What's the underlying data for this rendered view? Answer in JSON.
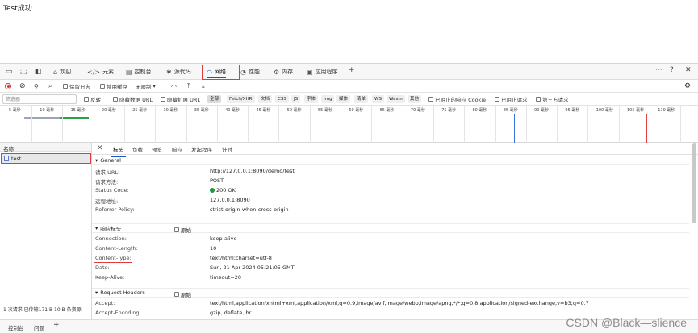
{
  "page": {
    "title": "Test成功"
  },
  "tabbar": {
    "tabs": [
      {
        "label": "欢迎",
        "icon": "home-icon"
      },
      {
        "label": "元素",
        "icon": "code-icon"
      },
      {
        "label": "控制台",
        "icon": "console-icon"
      },
      {
        "label": "源代码",
        "icon": "bug-icon"
      },
      {
        "label": "网络",
        "icon": "wifi-icon"
      },
      {
        "label": "性能",
        "icon": "performance-icon"
      },
      {
        "label": "内存",
        "icon": "memory-icon"
      },
      {
        "label": "应用程序",
        "icon": "app-icon"
      }
    ],
    "active": "网络",
    "add": "+",
    "more": "···",
    "help": "?",
    "close": "✕"
  },
  "toolbar1": {
    "preserve_log": "保留日志",
    "disable_cache": "禁用缓存",
    "throttle": "无限制"
  },
  "toolbar2": {
    "filter_placeholder": "筛选器",
    "invert": "反转",
    "hide_data_urls": "隐藏数据 URL",
    "hide_ext_urls": "隐藏扩展 URL",
    "chips": [
      "全部",
      "Fetch/XHR",
      "文档",
      "CSS",
      "JS",
      "字体",
      "Img",
      "媒体",
      "清单",
      "WS",
      "Wasm",
      "其他"
    ],
    "blocked_cookies": "已阻止的响应 Cookie",
    "blocked_requests": "已阻止请求",
    "third_party": "第三方请求"
  },
  "timeline": {
    "ticks": [
      "5 毫秒",
      "10 毫秒",
      "15 毫秒",
      "20 毫秒",
      "25 毫秒",
      "30 毫秒",
      "35 毫秒",
      "40 毫秒",
      "45 毫秒",
      "50 毫秒",
      "55 毫秒",
      "60 毫秒",
      "65 毫秒",
      "70 毫秒",
      "75 毫秒",
      "80 毫秒",
      "85 毫秒",
      "90 毫秒",
      "95 毫秒",
      "100 毫秒",
      "105 毫秒",
      "110 毫秒"
    ]
  },
  "requests": {
    "header": "名称",
    "items": [
      {
        "name": "test"
      }
    ]
  },
  "detail_tabs": [
    "标头",
    "负载",
    "预览",
    "响应",
    "发起程序",
    "计时"
  ],
  "general": {
    "title": "General",
    "rows": [
      {
        "key": "请求 URL:",
        "value": "http://127.0.0.1:8090/demo/test"
      },
      {
        "key": "请求方法:",
        "value": "POST"
      },
      {
        "key": "Status Code:",
        "value": "200 OK"
      },
      {
        "key": "远程地址:",
        "value": "127.0.0.1:8090"
      },
      {
        "key": "Referrer Policy:",
        "value": "strict-origin-when-cross-origin"
      }
    ]
  },
  "response_headers": {
    "title": "响应标头",
    "raw": "原始",
    "rows": [
      {
        "key": "Connection:",
        "value": "keep-alive"
      },
      {
        "key": "Content-Length:",
        "value": "10"
      },
      {
        "key": "Content-Type:",
        "value": "text/html;charset=utf-8"
      },
      {
        "key": "Date:",
        "value": "Sun, 21 Apr 2024 05:21:05 GMT"
      },
      {
        "key": "Keep-Alive:",
        "value": "timeout=20"
      }
    ]
  },
  "request_headers": {
    "title": "Request Headers",
    "raw": "原始",
    "rows": [
      {
        "key": "Accept:",
        "value": "text/html,application/xhtml+xml,application/xml;q=0.9,image/avif,image/webp,image/apng,*/*;q=0.8,application/signed-exchange;v=b3;q=0.7"
      },
      {
        "key": "Accept-Encoding:",
        "value": "gzip, deflate, br"
      }
    ]
  },
  "status": "1 次请求  已传输171 B  10 B 条资源",
  "drawer": {
    "tabs": [
      "控制台",
      "问题"
    ],
    "active": "问题",
    "add": "+"
  },
  "watermark": "CSDN @Black—slience"
}
